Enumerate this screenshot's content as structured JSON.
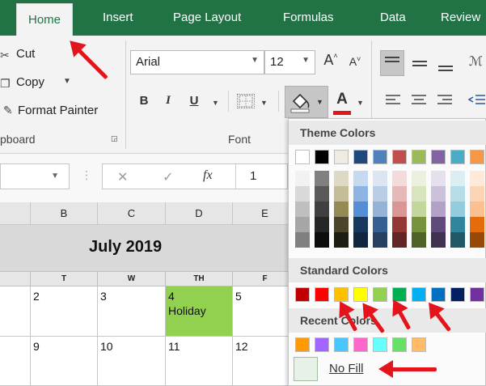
{
  "tabs": [
    {
      "label": "Home",
      "active": true
    },
    {
      "label": "Insert"
    },
    {
      "label": "Page Layout"
    },
    {
      "label": "Formulas"
    },
    {
      "label": "Data"
    },
    {
      "label": "Review"
    }
  ],
  "clipboard": {
    "cut_label": "Cut",
    "copy_label": "Copy",
    "format_painter_label": "Format Painter",
    "group_label": "pboard"
  },
  "font": {
    "font_name": "Arial",
    "font_size": "12",
    "grow_label": "A",
    "shrink_label": "A",
    "bold_label": "B",
    "italic_label": "I",
    "underline_label": "U",
    "font_color_label": "A",
    "group_label": "Font"
  },
  "formula": {
    "cancel_glyph": "✕",
    "enter_glyph": "✓",
    "fx_label": "fx",
    "value": "1"
  },
  "columns": [
    "B",
    "C",
    "D",
    "E"
  ],
  "calendar": {
    "title": "July 2019",
    "day_headers": [
      "T",
      "W",
      "TH",
      "F"
    ],
    "rows": [
      [
        "2",
        "3",
        "4",
        "5"
      ],
      [
        "9",
        "10",
        "11",
        "12"
      ]
    ],
    "holiday_label": "Holiday"
  },
  "palette": {
    "theme_title": "Theme Colors",
    "standard_title": "Standard Colors",
    "recent_title": "Recent Colors",
    "no_fill_label": "No Fill",
    "theme_top": [
      "#ffffff",
      "#000000",
      "#eeece1",
      "#1f497d",
      "#4f81bd",
      "#c0504d",
      "#9bbb59",
      "#8064a2",
      "#4bacc6",
      "#f79646"
    ],
    "theme_shades": [
      [
        "#f2f2f2",
        "#d9d9d9",
        "#bfbfbf",
        "#a6a6a6",
        "#808080"
      ],
      [
        "#808080",
        "#595959",
        "#404040",
        "#262626",
        "#0d0d0d"
      ],
      [
        "#ddd9c4",
        "#c4bd97",
        "#948a54",
        "#4a452a",
        "#1e1c11"
      ],
      [
        "#c6d9f1",
        "#8eb4e3",
        "#558ed5",
        "#17375e",
        "#10253f"
      ],
      [
        "#dce6f2",
        "#b9cde5",
        "#95b3d7",
        "#376092",
        "#254061"
      ],
      [
        "#f2dcdb",
        "#e6b9b8",
        "#d99694",
        "#953735",
        "#632523"
      ],
      [
        "#ebf1de",
        "#d7e4bd",
        "#c3d69b",
        "#77933c",
        "#4f6228"
      ],
      [
        "#e6e0ec",
        "#ccc1da",
        "#b3a2c7",
        "#604a7b",
        "#403152"
      ],
      [
        "#dbeef4",
        "#b7dee8",
        "#93cddd",
        "#31859c",
        "#215968"
      ],
      [
        "#fdeada",
        "#fcd5b5",
        "#fac090",
        "#e46c0a",
        "#984807"
      ]
    ],
    "standard": [
      "#c00000",
      "#ff0000",
      "#ffc000",
      "#ffff00",
      "#92d050",
      "#00b050",
      "#00b0f0",
      "#0070c0",
      "#002060",
      "#7030a0"
    ],
    "recent": [
      "#ff9a00",
      "#a066ff",
      "#46c8ff",
      "#ff66cc",
      "#66ffff",
      "#66e066",
      "#ffbb66"
    ]
  },
  "colors": {
    "ribbon_green": "#217346",
    "holiday_fill": "#92d050",
    "arrow_red": "#e3141b"
  }
}
